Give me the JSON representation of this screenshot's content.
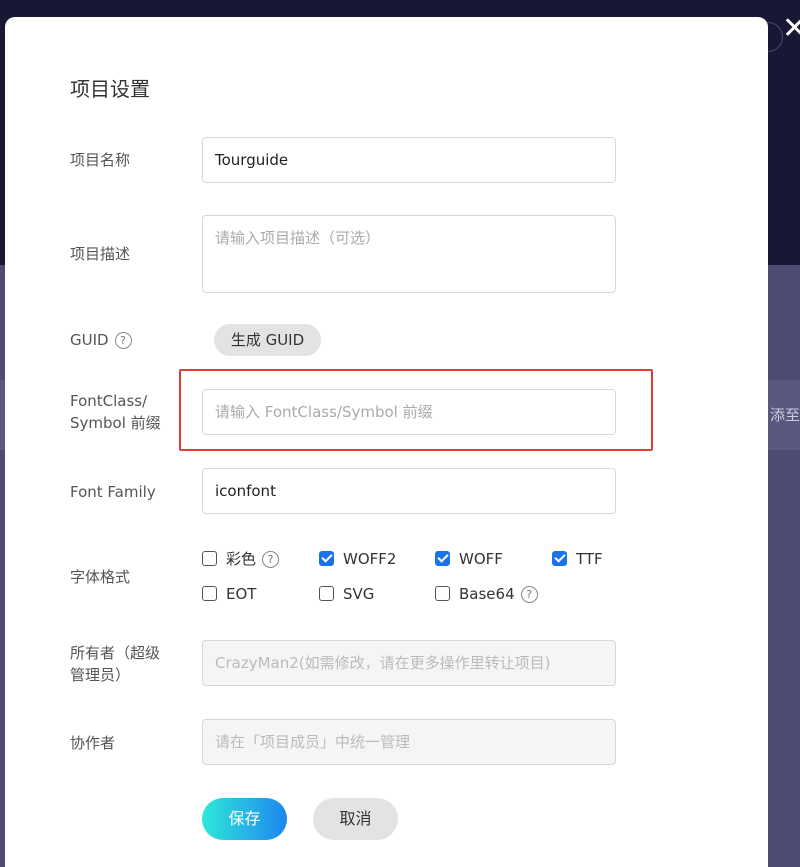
{
  "background": {
    "edge_text": "添至项"
  },
  "modal": {
    "title": "项目设置",
    "fields": {
      "name": {
        "label": "项目名称",
        "value": "Tourguide"
      },
      "description": {
        "label": "项目描述",
        "placeholder": "请输入项目描述（可选）"
      },
      "guid": {
        "label": "GUID",
        "button": "生成 GUID"
      },
      "prefix": {
        "label_line1": "FontClass/",
        "label_line2": "Symbol 前缀",
        "placeholder": "请输入 FontClass/Symbol 前缀"
      },
      "font_family": {
        "label": "Font Family",
        "value": "iconfont"
      },
      "formats": {
        "label": "字体格式",
        "options": [
          {
            "label": "彩色",
            "checked": false,
            "help": true
          },
          {
            "label": "WOFF2",
            "checked": true
          },
          {
            "label": "WOFF",
            "checked": true
          },
          {
            "label": "TTF",
            "checked": true
          },
          {
            "label": "EOT",
            "checked": false
          },
          {
            "label": "SVG",
            "checked": false
          },
          {
            "label": "Base64",
            "checked": false,
            "help": true
          }
        ]
      },
      "owner": {
        "label_line1": "所有者（超级",
        "label_line2": "管理员）",
        "placeholder": "CrazyMan2(如需修改，请在更多操作里转让项目)"
      },
      "collaborators": {
        "label": "协作者",
        "placeholder": "请在「项目成员」中统一管理"
      }
    },
    "buttons": {
      "save": "保存",
      "cancel": "取消"
    },
    "help_glyph": "?"
  },
  "colors": {
    "accent_blue": "#1a73e8",
    "highlight_red": "#e53935",
    "save_gradient_start": "#2ee8d8",
    "save_gradient_end": "#1d86f0"
  },
  "icons": {
    "close": "close-icon",
    "help": "question-circle-icon",
    "checkbox": "checkbox-icon"
  }
}
